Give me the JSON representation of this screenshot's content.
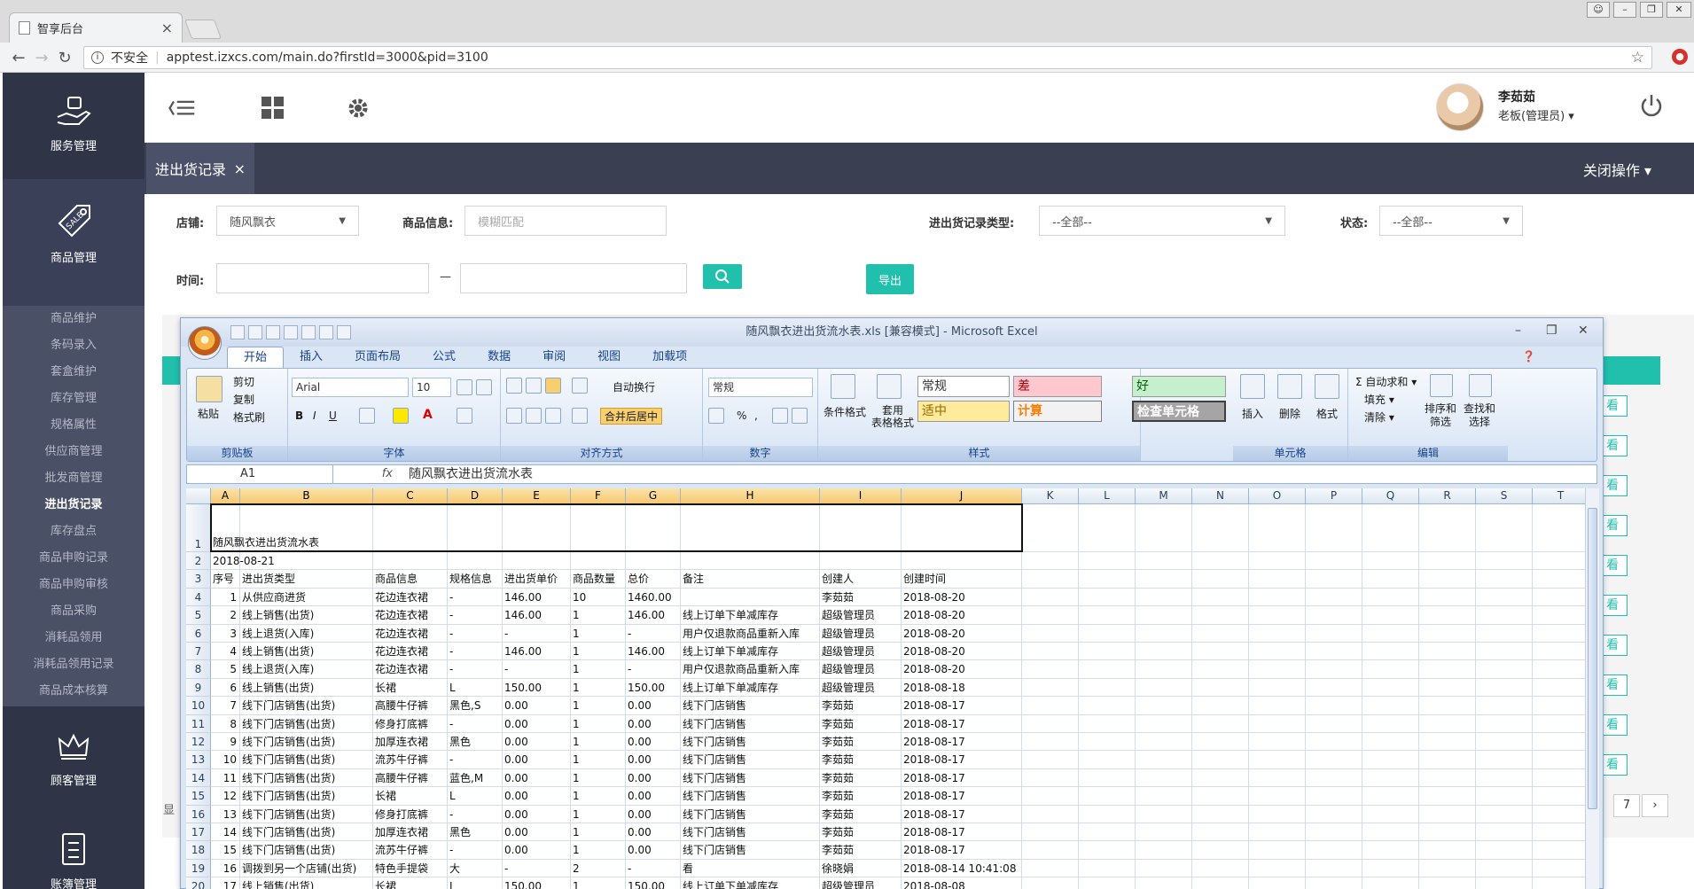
{
  "browser": {
    "tab_title": "智享后台",
    "tab_close": "×",
    "insecure_label": "不安全",
    "url": "apptest.izxcs.com/main.do?firstId=3000&pid=3100"
  },
  "sidebar": {
    "top_items": [
      {
        "label": "服务管理",
        "icon": "service-hand-icon"
      },
      {
        "label": "商品管理",
        "icon": "sale-tag-icon"
      }
    ],
    "submenu": [
      "商品维护",
      "条码录入",
      "套盒维护",
      "库存管理",
      "规格属性",
      "供应商管理",
      "批发商管理",
      "进出货记录",
      "库存盘点",
      "商品申购记录",
      "商品申购审核",
      "商品采购",
      "消耗品领用",
      "消耗品领用记录",
      "商品成本核算"
    ],
    "active_sub": "进出货记录",
    "bottom_items": [
      {
        "label": "顾客管理",
        "icon": "crown-icon"
      },
      {
        "label": "账簿管理",
        "icon": "ledger-icon"
      }
    ]
  },
  "header": {
    "user_name": "李茹茹",
    "user_role": "老板(管理员) ▾"
  },
  "tabbar": {
    "current_tab": "进出货记录",
    "tab_close": "×",
    "close_ops": "关闭操作 ▾"
  },
  "filters": {
    "store_label": "店铺:",
    "store_value": "随风飘衣",
    "product_label": "商品信息:",
    "product_placeholder": "模糊匹配",
    "type_label": "进出货记录类型:",
    "type_value": "--全部--",
    "status_label": "状态:",
    "status_value": "--全部--",
    "time_label": "时间:",
    "time_sep": "—",
    "export_label": "导出"
  },
  "bgpage": {
    "view_label": "看",
    "pager_num": "7",
    "pager_next": "›",
    "partial_left": "显"
  },
  "excel": {
    "title": "随风飘衣进出货流水表.xls  [兼容模式] - Microsoft Excel",
    "tabs": [
      "开始",
      "插入",
      "页面布局",
      "公式",
      "数据",
      "审阅",
      "视图",
      "加载项"
    ],
    "active_tab": "开始",
    "ribbon": {
      "paste": "粘贴",
      "cut": "剪切",
      "copy": "复制",
      "format_painter": "格式刷",
      "g_clipboard": "剪贴板",
      "font": "Arial",
      "size": "10",
      "g_font": "字体",
      "wrap": "自动换行",
      "merge": "合并后居中",
      "g_align": "对齐方式",
      "num_format": "常规",
      "g_number": "数字",
      "cond_format": "条件格式",
      "table_format": "套用\n表格格式",
      "s_normal": "常规",
      "s_bad": "差",
      "s_good": "好",
      "s_neutral": "适中",
      "s_calc": "计算",
      "s_check": "检查单元格",
      "g_styles": "样式",
      "insert": "插入",
      "delete": "删除",
      "format": "格式",
      "g_cells": "单元格",
      "autosum": "Σ 自动求和 ▾",
      "fill": "填充 ▾",
      "clear": "清除 ▾",
      "sort": "排序和\n筛选",
      "find": "查找和\n选择",
      "g_edit": "编辑"
    },
    "namebox": "A1",
    "fx": "fx",
    "formula": "随风飘衣进出货流水表",
    "columns": [
      "A",
      "B",
      "C",
      "D",
      "E",
      "F",
      "G",
      "H",
      "I",
      "J",
      "K",
      "L",
      "M",
      "N",
      "O",
      "P",
      "Q",
      "R",
      "S",
      "T"
    ],
    "title_cell": "随风飘衣进出货流水表",
    "date_cell": "2018-08-21",
    "headers": [
      "序号",
      "进出货类型",
      "商品信息",
      "规格信息",
      "进出货单价",
      "商品数量",
      "总价",
      "备注",
      "创建人",
      "创建时间"
    ],
    "rows": [
      [
        "1",
        "从供应商进货",
        "花边连衣裙",
        "-",
        "146.00",
        "10",
        "1460.00",
        "",
        "李茹茹",
        "2018-08-20"
      ],
      [
        "2",
        "线上销售(出货)",
        "花边连衣裙",
        "-",
        "146.00",
        "1",
        "146.00",
        "线上订单下单减库存",
        "超级管理员",
        "2018-08-20"
      ],
      [
        "3",
        "线上退货(入库)",
        "花边连衣裙",
        "-",
        "-",
        "1",
        "-",
        "用户仅退款商品重新入库",
        "超级管理员",
        "2018-08-20"
      ],
      [
        "4",
        "线上销售(出货)",
        "花边连衣裙",
        "-",
        "146.00",
        "1",
        "146.00",
        "线上订单下单减库存",
        "超级管理员",
        "2018-08-20"
      ],
      [
        "5",
        "线上退货(入库)",
        "花边连衣裙",
        "-",
        "-",
        "1",
        "-",
        "用户仅退款商品重新入库",
        "超级管理员",
        "2018-08-20"
      ],
      [
        "6",
        "线上销售(出货)",
        "长裙",
        "L",
        "150.00",
        "1",
        "150.00",
        "线上订单下单减库存",
        "超级管理员",
        "2018-08-18"
      ],
      [
        "7",
        "线下门店销售(出货)",
        "高腰牛仔裤",
        "黑色,S",
        "0.00",
        "1",
        "0.00",
        "线下门店销售",
        "李茹茹",
        "2018-08-17"
      ],
      [
        "8",
        "线下门店销售(出货)",
        "修身打底裤",
        "-",
        "0.00",
        "1",
        "0.00",
        "线下门店销售",
        "李茹茹",
        "2018-08-17"
      ],
      [
        "9",
        "线下门店销售(出货)",
        "加厚连衣裙",
        "黑色",
        "0.00",
        "1",
        "0.00",
        "线下门店销售",
        "李茹茹",
        "2018-08-17"
      ],
      [
        "10",
        "线下门店销售(出货)",
        "流苏牛仔裤",
        "-",
        "0.00",
        "1",
        "0.00",
        "线下门店销售",
        "李茹茹",
        "2018-08-17"
      ],
      [
        "11",
        "线下门店销售(出货)",
        "高腰牛仔裤",
        "蓝色,M",
        "0.00",
        "1",
        "0.00",
        "线下门店销售",
        "李茹茹",
        "2018-08-17"
      ],
      [
        "12",
        "线下门店销售(出货)",
        "长裙",
        "L",
        "0.00",
        "1",
        "0.00",
        "线下门店销售",
        "李茹茹",
        "2018-08-17"
      ],
      [
        "13",
        "线下门店销售(出货)",
        "修身打底裤",
        "-",
        "0.00",
        "1",
        "0.00",
        "线下门店销售",
        "李茹茹",
        "2018-08-17"
      ],
      [
        "14",
        "线下门店销售(出货)",
        "加厚连衣裙",
        "黑色",
        "0.00",
        "1",
        "0.00",
        "线下门店销售",
        "李茹茹",
        "2018-08-17"
      ],
      [
        "15",
        "线下门店销售(出货)",
        "流苏牛仔裤",
        "-",
        "0.00",
        "1",
        "0.00",
        "线下门店销售",
        "李茹茹",
        "2018-08-17"
      ],
      [
        "16",
        "调拨到另一个店铺(出货)",
        "特色手提袋",
        "大",
        "-",
        "2",
        "-",
        "看",
        "徐晓娟",
        "2018-08-14 10:41:08"
      ],
      [
        "17",
        "线上销售(出货)",
        "长裙",
        "L",
        "150.00",
        "1",
        "150.00",
        "线上订单下单减库存",
        "超级管理员",
        "2018-08-08"
      ]
    ],
    "row_numbers": [
      "1",
      "2",
      "3",
      "4",
      "5",
      "6",
      "7",
      "8",
      "9",
      "10",
      "11",
      "12",
      "13",
      "14",
      "15",
      "16",
      "17",
      "18",
      "19",
      "20"
    ]
  }
}
